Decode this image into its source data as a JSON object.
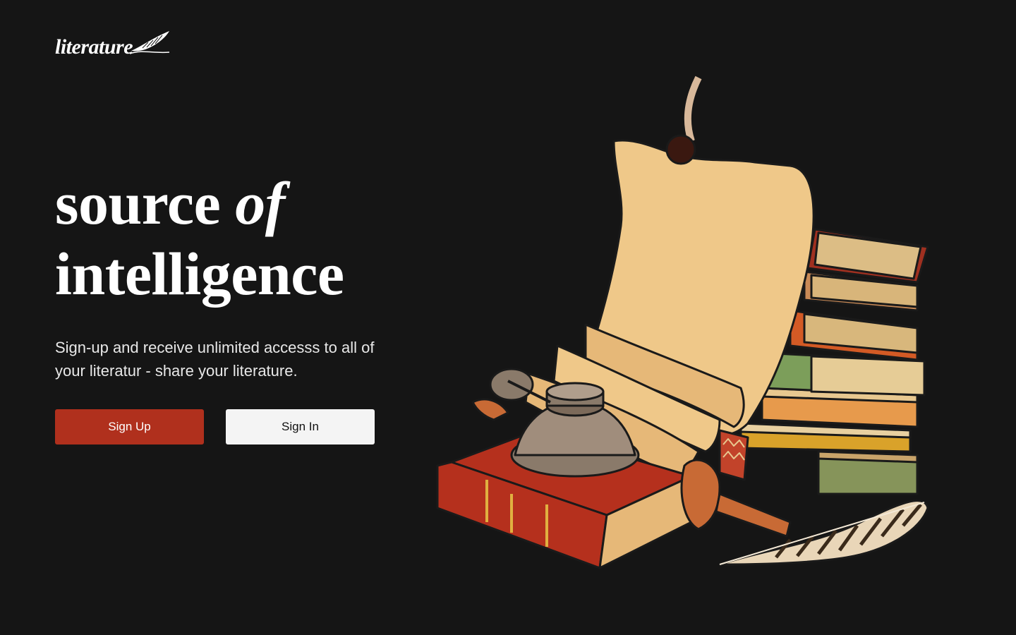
{
  "brand": {
    "name": "literature",
    "icon": "quill-icon"
  },
  "hero": {
    "headline_part1": "source ",
    "headline_em": "of",
    "headline_part2": "intelligence",
    "subtext": "Sign-up and receive unlimited accesss to all of your literatur - share your literature."
  },
  "actions": {
    "sign_up_label": "Sign Up",
    "sign_in_label": "Sign In"
  },
  "illustration": {
    "subject": "illustration-books-scroll-inkwell-quill"
  },
  "colors": {
    "background": "#151515",
    "primary": "#b0301d",
    "secondary": "#f4f4f4",
    "text": "#ffffff"
  }
}
